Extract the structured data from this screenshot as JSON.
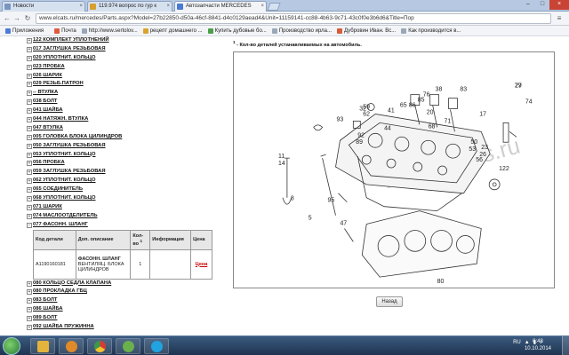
{
  "browser": {
    "tabs": [
      {
        "label": "Новости"
      },
      {
        "label": "119.974 вопрос по гур к"
      },
      {
        "label": "Автозапчасти MERCEDES"
      }
    ],
    "url": "www.elcats.ru/mercedes/Parts.aspx?Model=27b22850-d50a-46cf-8841-d4c0129aead4&Unit=11159141-cc88-4b63-9c71-43c0f0e3b6d6&Title=Пор",
    "bookmarks": [
      {
        "label": "Приложения"
      },
      {
        "label": "Почта"
      },
      {
        "label": "http://www.sertolov..."
      },
      {
        "label": "рецепт домашнего ..."
      },
      {
        "label": "Купить дубовые бо..."
      },
      {
        "label": "Производство ирла..."
      },
      {
        "label": "Дубровин Иван. Вс..."
      },
      {
        "label": "Как производится в..."
      }
    ]
  },
  "tree": {
    "items_before": [
      {
        "pm": "+",
        "label": "122 КОМПЛЕКТ УПЛОТНЕНИЙ"
      },
      {
        "pm": "+",
        "label": "017 ЗАГЛУШКА РЕЗЬБОВАЯ"
      },
      {
        "pm": "+",
        "label": "020 УПЛОТНИТ. КОЛЬЦО"
      },
      {
        "pm": "+",
        "label": "023 ПРОБКА"
      },
      {
        "pm": "+",
        "label": "026 ШАРИК"
      },
      {
        "pm": "+",
        "label": "029 РЕЗЬБ.ПАТРОН"
      },
      {
        "pm": "+",
        "label": "-- ВТУЛКА"
      },
      {
        "pm": "+",
        "label": "038 БОЛТ"
      },
      {
        "pm": "+",
        "label": "041 ШАЙБА"
      },
      {
        "pm": "+",
        "label": "044 НАТЯЖН. ВТУЛКА"
      },
      {
        "pm": "+",
        "label": "047 ВТУЛКА"
      },
      {
        "pm": "+",
        "label": "005 ГОЛОВКА БЛОКА ЦИЛИНДРОВ"
      },
      {
        "pm": "+",
        "label": "050 ЗАГЛУШКА РЕЗЬБОВАЯ"
      },
      {
        "pm": "+",
        "label": "053 УПЛОТНИТ. КОЛЬЦО"
      },
      {
        "pm": "+",
        "label": "056 ПРОБКА"
      },
      {
        "pm": "+",
        "label": "059 ЗАГЛУШКА РЕЗЬБОВАЯ"
      },
      {
        "pm": "+",
        "label": "062 УПЛОТНИТ. КОЛЬЦО"
      },
      {
        "pm": "+",
        "label": "065 СОЕДИНИТЕЛЬ"
      },
      {
        "pm": "+",
        "label": "068 УПЛОТНИТ. КОЛЬЦО"
      },
      {
        "pm": "+",
        "label": "071 ШАРИК"
      },
      {
        "pm": "+",
        "label": "074 МАСЛООТДЕЛИТЕЛЬ"
      },
      {
        "pm": "−",
        "label": "077 ФАСОНН. ШЛАНГ"
      }
    ],
    "subtable": {
      "headers": [
        "Код детали",
        "Доп. описание",
        "Кол-во",
        "Информация",
        "Цена"
      ],
      "footnote_mark": "1",
      "row": {
        "code": "A1190160181",
        "desc_title": "ФАСОНН. ШЛАНГ",
        "desc_text": "ВЕНТИЛЯЦ. БЛОКА ЦИЛИНДРОВ",
        "qty": "1",
        "info": "",
        "price": "Цена"
      }
    },
    "items_after": [
      {
        "pm": "+",
        "label": "080 КОЛЬЦО СЕДЛА КЛАПАНА"
      },
      {
        "pm": "+",
        "label": "080 ПРОКЛАДКА ГБЦ"
      },
      {
        "pm": "+",
        "label": "083 БОЛТ"
      },
      {
        "pm": "+",
        "label": "086 ШАЙБА"
      },
      {
        "pm": "+",
        "label": "089 БОЛТ"
      },
      {
        "pm": "+",
        "label": "092 ШАЙБА ПРУЖИННА"
      }
    ]
  },
  "diagram": {
    "heading_mark": "1",
    "heading": "- Кол-во деталей устанавливаемых на автомобиль.",
    "watermark": "www.elcats.ru",
    "callouts": [
      "77",
      "74",
      "38",
      "76",
      "83",
      "85",
      "86",
      "20",
      "65",
      "41",
      "44",
      "68",
      "32",
      "17",
      "71",
      "23",
      "26",
      "59",
      "62",
      "92",
      "93",
      "89",
      "50",
      "56",
      "53",
      "122",
      "11",
      "14",
      "95",
      "47",
      "29",
      "80",
      "8",
      "5"
    ]
  },
  "back_button": "Назад",
  "taskbar": {
    "tray_lang": "RU",
    "clock_time": "0:48",
    "clock_date": "10.10.2014"
  }
}
